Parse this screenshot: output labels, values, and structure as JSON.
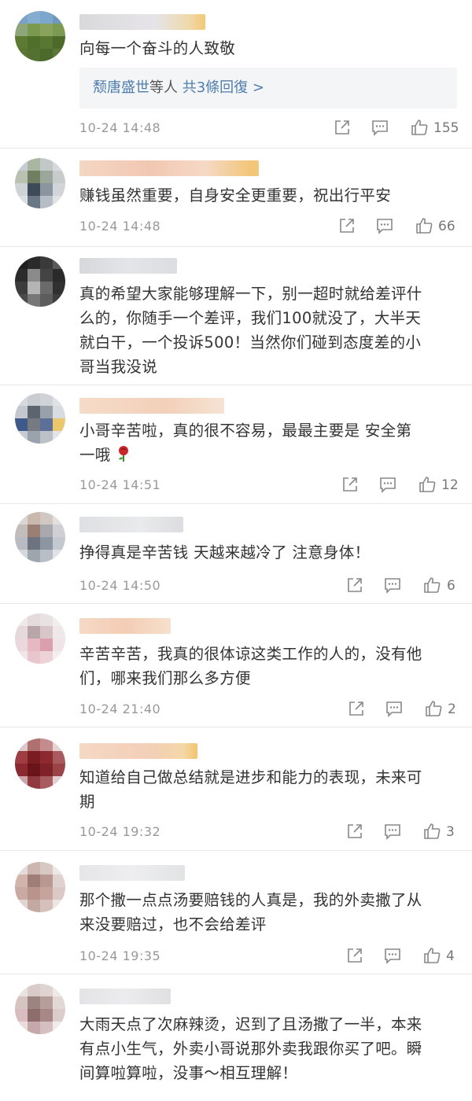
{
  "comments": [
    {
      "text": "向每一个奋斗的人致敬",
      "reply": {
        "who": "颓唐盛世",
        "etc": "等人",
        "count_text": "共3條回復 >"
      },
      "time": "10-24 14:48",
      "likes": "155"
    },
    {
      "text": "赚钱虽然重要，自身安全更重要，祝出行平安",
      "time": "10-24 14:48",
      "likes": "66"
    },
    {
      "text": "真的希望大家能够理解一下，别一超时就给差评什\n么的，你随手一个差评，我们100就没了，大半天\n就白干，一个投诉500！当然你们碰到态度差的小\n哥当我没说"
    },
    {
      "text": "小哥辛苦啦，真的很不容易，最最主要是 安全第\n一哦",
      "time": "10-24 14:51",
      "likes": "12"
    },
    {
      "text": "挣得真是辛苦钱 天越来越冷了 注意身体！",
      "time": "10-24 14:50",
      "likes": "6"
    },
    {
      "text": "辛苦辛苦，我真的很体谅这类工作的人的，没有他\n们，哪来我们那么多方便",
      "time": "10-24 21:40",
      "likes": "2"
    },
    {
      "text": "知道给自己做总结就是进步和能力的表现，未来可\n期",
      "time": "10-24 19:32",
      "likes": "3"
    },
    {
      "text": "那个撒一点点汤要赔钱的人真是，我的外卖撒了从\n来没要赔过，也不会给差评",
      "time": "10-24 19:35",
      "likes": "4"
    },
    {
      "text": "大雨天点了次麻辣烫，迟到了且汤撒了一半，本来\n有点小生气，外卖小哥说那外卖我跟你买了吧。瞬\n间算啦算啦，没事～相互理解！"
    }
  ],
  "icons": {
    "share": "share-icon",
    "comment": "comment-icon",
    "like": "thumbs-up-icon",
    "rose": "rose-emoji"
  },
  "colors": {
    "link": "#4f7dae",
    "meta": "#999999",
    "reply_bg": "#f4f5f7"
  }
}
